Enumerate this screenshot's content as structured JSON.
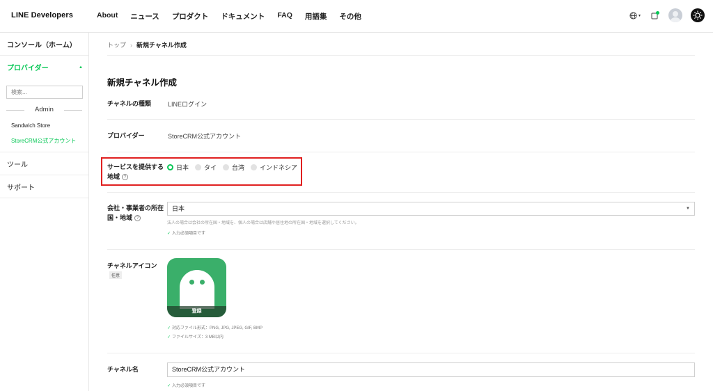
{
  "header": {
    "brand": "LINE Developers",
    "nav": [
      "About",
      "ニュース",
      "プロダクト",
      "ドキュメント",
      "FAQ",
      "用語集",
      "その他"
    ],
    "icons": [
      "globe-icon",
      "notification-icon",
      "avatar",
      "theme-toggle-icon"
    ],
    "accent_color": "#06c755"
  },
  "sidebar": {
    "console_home": "コンソール（ホーム）",
    "providers_label": "プロバイダー",
    "search_placeholder": "検索...",
    "admin_label": "Admin",
    "providers": [
      "Sandwich Store",
      "StoreCRM公式アカウント"
    ],
    "tools": "ツール",
    "support": "サポート"
  },
  "main": {
    "breadcrumb": {
      "top": "トップ",
      "current": "新規チャネル作成"
    },
    "page_title": "新規チャネル作成",
    "channel_type": {
      "label": "チャネルの種類",
      "value": "LINEログイン"
    },
    "provider": {
      "label": "プロバイダー",
      "value": "StoreCRM公式アカウント"
    },
    "region": {
      "label_line1": "サービスを提供する",
      "label_line2": "地域",
      "options": [
        "日本",
        "タイ",
        "台湾",
        "インドネシア"
      ],
      "selected": "日本"
    },
    "country": {
      "label_line1": "会社・事業者の所在",
      "label_line2": "国・地域",
      "value": "日本",
      "hint": "法人の場合は会社の所在国・地域を、個人の場合は店舗や居住地の所在国・地域を選択してください。",
      "required": "入力必須項目です"
    },
    "channel_icon": {
      "label": "チャネルアイコン",
      "badge": "任意",
      "button": "登録",
      "formats": "対応ファイル形式：PNG, JPG, JPEG, GIF, BMP",
      "size": "ファイルサイズ：3 MB以内"
    },
    "channel_name": {
      "label": "チャネル名",
      "value": "StoreCRM公式アカウント",
      "required": "入力必須項目です"
    }
  }
}
